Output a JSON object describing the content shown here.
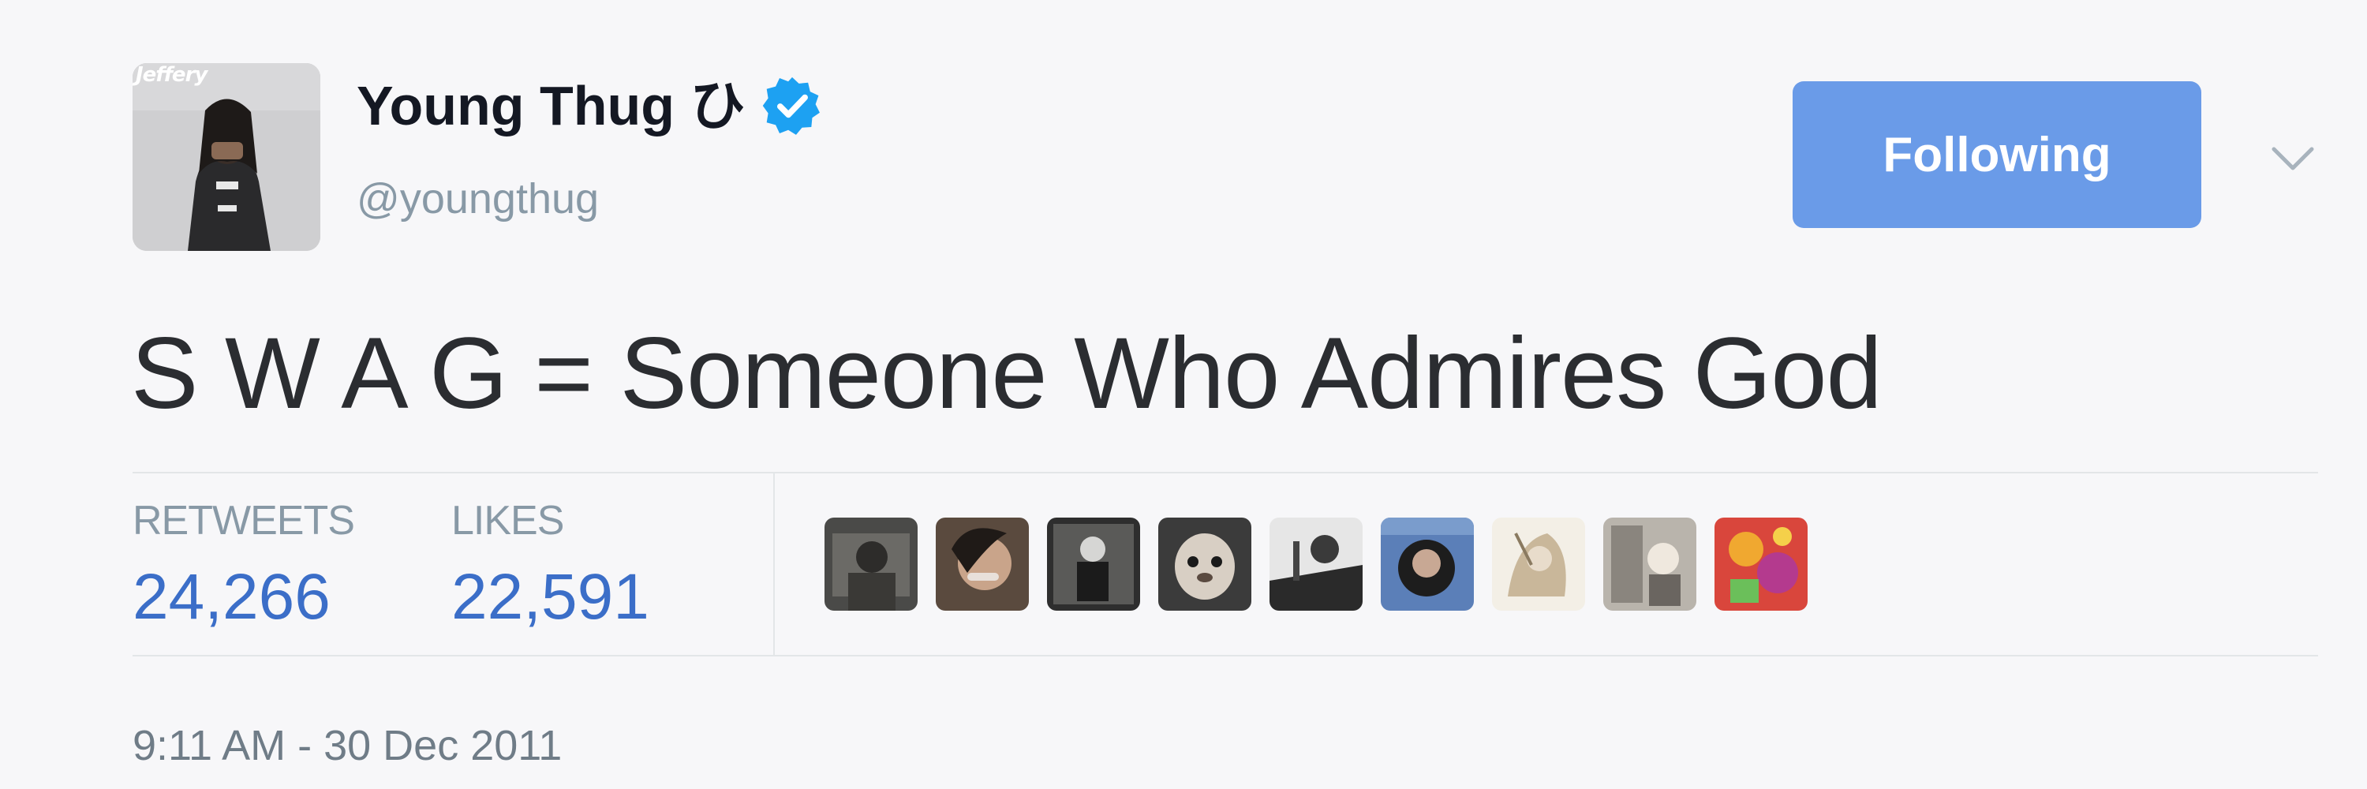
{
  "user": {
    "display_name": "Young Thug ひ",
    "handle": "@youngthug",
    "avatar_tag": "Jeffery",
    "verified_icon": "verified-badge-icon",
    "avatar_icon": "avatar-photo"
  },
  "actions": {
    "follow_label": "Following",
    "menu_icon": "chevron-down-icon"
  },
  "tweet": {
    "text": "S W A G = Someone Who Admires God",
    "timestamp": "9:11 AM - 30 Dec 2011"
  },
  "stats": {
    "retweets_label": "RETWEETS",
    "retweets_value": "24,266",
    "likes_label": "LIKES",
    "likes_value": "22,591"
  },
  "likers": [
    {
      "icon": "liker-avatar-1"
    },
    {
      "icon": "liker-avatar-2"
    },
    {
      "icon": "liker-avatar-3"
    },
    {
      "icon": "liker-avatar-4"
    },
    {
      "icon": "liker-avatar-5"
    },
    {
      "icon": "liker-avatar-6"
    },
    {
      "icon": "liker-avatar-7"
    },
    {
      "icon": "liker-avatar-8"
    },
    {
      "icon": "liker-avatar-9"
    }
  ],
  "colors": {
    "background": "#f7f7f9",
    "follow_button": "#6a9be8",
    "stat_values": "#3b6ec8",
    "verified": "#1da1f2",
    "muted_text": "#8899a6"
  }
}
